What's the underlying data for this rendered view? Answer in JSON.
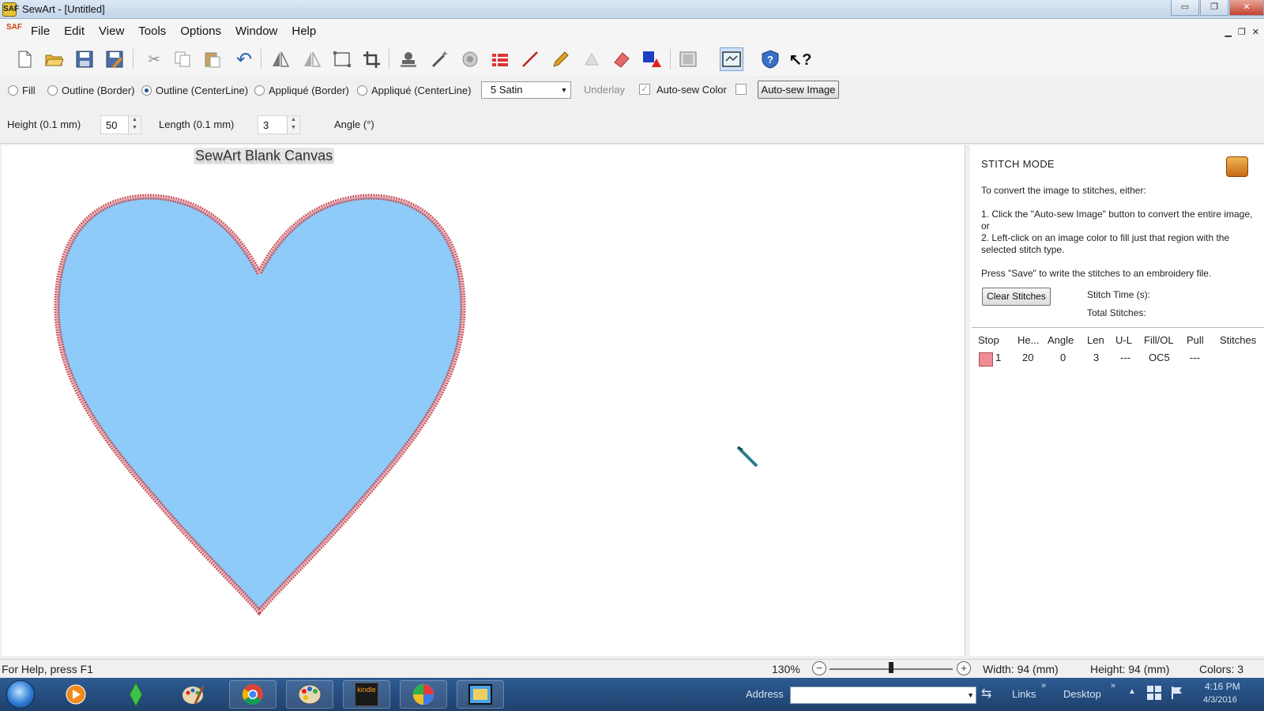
{
  "window": {
    "title": "SewArt - [Untitled]",
    "app_icon_label": "SAF",
    "controls": {
      "minimize": "▭",
      "restore": "❐",
      "close": "✕"
    }
  },
  "menu": {
    "items": [
      "File",
      "Edit",
      "View",
      "Tools",
      "Options",
      "Window",
      "Help"
    ],
    "mdi_controls": {
      "minimize": "▁",
      "restore": "❐",
      "close": "✕"
    }
  },
  "toolbar": {
    "icons": [
      "new-icon",
      "open-icon",
      "save-icon",
      "save-as-icon",
      "cut-icon",
      "copy-icon",
      "paste-icon",
      "undo-icon",
      "mirror-horizontal-icon",
      "mirror-vertical-icon",
      "resize-icon",
      "crop-icon",
      "stamp-icon",
      "wand-icon",
      "merge-icon",
      "color-list-icon",
      "line-icon",
      "pencil-icon",
      "fill-icon",
      "eraser-icon",
      "shapes-icon",
      "grid-icon",
      "stitch-mode-icon",
      "help-icon",
      "context-help-icon"
    ]
  },
  "stitch_options": {
    "radios": [
      {
        "label": "Fill",
        "selected": false
      },
      {
        "label": "Outline (Border)",
        "selected": false
      },
      {
        "label": "Outline (CenterLine)",
        "selected": true
      },
      {
        "label": "Appliqué (Border)",
        "selected": false
      },
      {
        "label": "Appliqué (CenterLine)",
        "selected": false
      }
    ],
    "stitch_type": "5 Satin",
    "underlay_label": "Underlay",
    "autosew_color_label": "Auto-sew Color",
    "autosew_color_checked": true,
    "autosew_image_button": "Auto-sew Image"
  },
  "size_settings": {
    "height_label": "Height (0.1 mm)",
    "height_value": "50",
    "length_label": "Length (0.1 mm)",
    "length_value": "3",
    "angle_label": "Angle (°)"
  },
  "canvas": {
    "title": "SewArt Blank Canvas",
    "heart_fill": "#8ecbf8",
    "heart_outline": "#c8505a"
  },
  "panel": {
    "title": "STITCH MODE",
    "intro": "To convert the image to stitches, either:",
    "step1": "1. Click the \"Auto-sew Image\" button to convert the entire image, or",
    "step2": "2. Left-click on an image color to fill just that region with the selected stitch type.",
    "save_note": "Press \"Save\" to write the stitches to an embroidery file.",
    "clear_button": "Clear Stitches",
    "stitch_time_label": "Stitch Time (s):",
    "total_stitches_label": "Total Stitches:",
    "table": {
      "headers": [
        "Stop",
        "He...",
        "Angle",
        "Len",
        "U-L",
        "Fill/OL",
        "Pull",
        "Stitches"
      ],
      "rows": [
        {
          "color": "#f08c96",
          "stop": "1",
          "height": "20",
          "angle": "0",
          "len": "3",
          "ul": "---",
          "fillol": "OC5",
          "pull": "---",
          "stitches": ""
        }
      ]
    }
  },
  "statusbar": {
    "help": "For Help, press F1",
    "zoom": "130%",
    "zoom_level_fraction": 0.5,
    "width": "Width: 94 (mm)",
    "height": "Height: 94 (mm)",
    "colors": "Colors: 3"
  },
  "taskbar": {
    "apps": [
      "media-player-icon",
      "sims-icon",
      "paint-icon",
      "chrome-icon",
      "palette-icon",
      "kindle-icon",
      "pinwheel-icon",
      "sewart-icon"
    ],
    "kindle_label": "kindle",
    "address_label": "Address",
    "links_label": "Links",
    "desktop_label": "Desktop",
    "time": "4:16 PM",
    "date": "4/3/2016"
  }
}
